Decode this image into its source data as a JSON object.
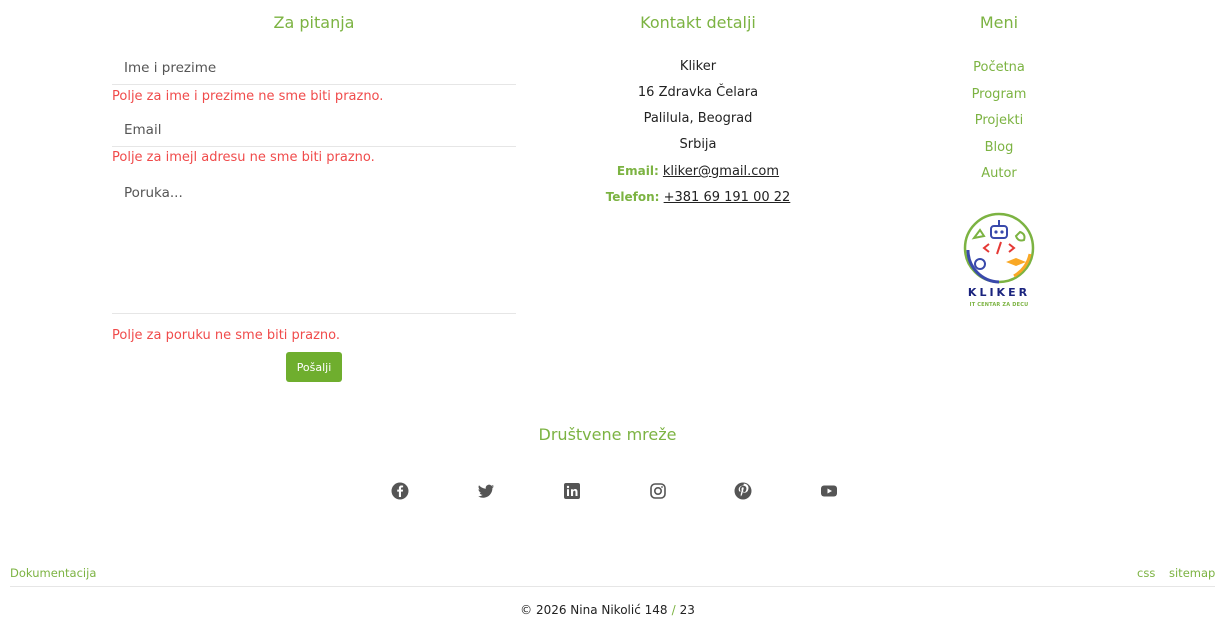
{
  "form": {
    "title": "Za pitanja",
    "name_placeholder": "Ime i prezime",
    "name_error": "Polje za ime i prezime ne sme biti prazno.",
    "email_placeholder": "Email",
    "email_error": "Polje za imejl adresu ne sme biti prazno.",
    "message_placeholder": "Poruka...",
    "message_error": "Polje za poruku ne sme biti prazno.",
    "submit_label": "Pošalji"
  },
  "contact": {
    "title": "Kontakt detalji",
    "company": "Kliker",
    "street": "16 Zdravka Čelara",
    "city": "Palilula, Beograd",
    "country": "Srbija",
    "email_label": "Email:",
    "email_value": "kliker@gmail.com",
    "phone_label": "Telefon:",
    "phone_value": "+381 69 191 00 22"
  },
  "menu": {
    "title": "Meni",
    "items": [
      "Početna",
      "Program",
      "Projekti",
      "Blog",
      "Autor"
    ]
  },
  "logo": {
    "title": "KLIKER",
    "subtitle": "IT CENTAR ZA DECU"
  },
  "social": {
    "title": "Društvene mreže",
    "icons": [
      "facebook-icon",
      "twitter-icon",
      "linkedin-icon",
      "instagram-icon",
      "pinterest-icon",
      "youtube-icon"
    ]
  },
  "footer": {
    "documentation": "Dokumentacija",
    "css": "css",
    "sitemap": "sitemap",
    "copyright_symbol": "©",
    "copyright_text": "2026 Nina Nikolić",
    "counter_a": "148",
    "counter_sep": "/",
    "counter_b": "23"
  },
  "colors": {
    "accent": "#7cb342",
    "button": "#6fae2e",
    "error": "#f04b4b",
    "icon": "#555555"
  }
}
